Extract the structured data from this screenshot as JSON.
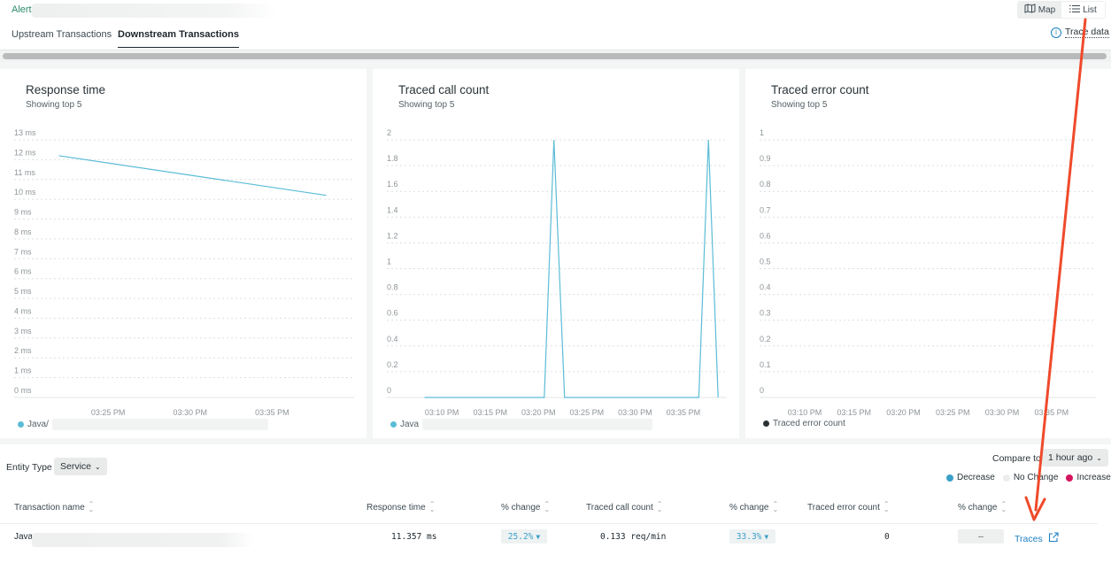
{
  "header": {
    "alert_label": "Alert",
    "tabs": [
      {
        "label": "Upstream Transactions",
        "active": false
      },
      {
        "label": "Downstream Transactions",
        "active": true
      }
    ],
    "view_toggle": [
      {
        "label": "Map",
        "icon": "map-icon",
        "active": false
      },
      {
        "label": "List",
        "icon": "list-icon",
        "active": true
      }
    ],
    "trace_data_label": "Trace data",
    "info_icon": "info-icon"
  },
  "colors": {
    "series": "#5bbcd6",
    "error_series": "#2b3134",
    "decrease": "#3aa0c9",
    "no_change": "#eceeee",
    "increase": "#d6145f",
    "link": "#1b7fc2",
    "annotation_arrow": "#ef4a2b"
  },
  "chart_data": [
    {
      "type": "line",
      "title": "Response time",
      "subtitle": "Showing top 5",
      "xlabel": "",
      "ylabel": "",
      "y_unit": "ms",
      "ylim": [
        0,
        13
      ],
      "yticks": [
        0,
        1,
        2,
        3,
        4,
        5,
        6,
        7,
        8,
        9,
        10,
        11,
        12,
        13
      ],
      "ytick_labels": [
        "0 ms",
        "1 ms",
        "2 ms",
        "3 ms",
        "4 ms",
        "5 ms",
        "6 ms",
        "7 ms",
        "8 ms",
        "9 ms",
        "10 ms",
        "11 ms",
        "12 ms",
        "13 ms"
      ],
      "x_range_min": [
        21.0,
        40.0
      ],
      "xticks_min": [
        25,
        30,
        35
      ],
      "xtick_labels": [
        "03:25 PM",
        "03:30 PM",
        "03:35 PM"
      ],
      "grid": true,
      "legend_position": "bottom-left",
      "series": [
        {
          "name": "Java/",
          "name_redacted": true,
          "x_min": [
            22.0,
            38.3
          ],
          "values": [
            12.2,
            10.2
          ]
        }
      ]
    },
    {
      "type": "line",
      "title": "Traced call count",
      "subtitle": "Showing top 5",
      "xlabel": "",
      "ylabel": "",
      "ylim": [
        0,
        2
      ],
      "yticks": [
        0,
        0.2,
        0.4,
        0.6,
        0.8,
        1,
        1.2,
        1.4,
        1.6,
        1.8,
        2
      ],
      "ytick_labels": [
        "0",
        "0.2",
        "0.4",
        "0.6",
        "0.8",
        "1",
        "1.2",
        "1.4",
        "1.6",
        "1.8",
        "2"
      ],
      "x_range_min": [
        6.5,
        39.5
      ],
      "xticks_min": [
        10,
        15,
        20,
        25,
        30,
        35
      ],
      "xtick_labels": [
        "03:10 PM",
        "03:15 PM",
        "03:20 PM",
        "03:25 PM",
        "03:30 PM",
        "03:35 PM"
      ],
      "grid": true,
      "legend_position": "bottom-left",
      "series": [
        {
          "name": "Java",
          "name_redacted": true,
          "x_min": [
            8.2,
            20.6,
            21.6,
            22.7,
            36.6,
            37.6,
            38.6
          ],
          "values": [
            0,
            0,
            2,
            0,
            0,
            2,
            0
          ]
        }
      ]
    },
    {
      "type": "line",
      "title": "Traced error count",
      "subtitle": "Showing top 5",
      "xlabel": "",
      "ylabel": "",
      "ylim": [
        0,
        1
      ],
      "yticks": [
        0,
        0.1,
        0.2,
        0.3,
        0.4,
        0.5,
        0.6,
        0.7,
        0.8,
        0.9,
        1
      ],
      "ytick_labels": [
        "0",
        "0.1",
        "0.2",
        "0.3",
        "0.4",
        "0.5",
        "0.6",
        "0.7",
        "0.8",
        "0.9",
        "1"
      ],
      "x_range_min": [
        6.5,
        39.5
      ],
      "xticks_min": [
        10,
        15,
        20,
        25,
        30,
        35
      ],
      "xtick_labels": [
        "03:10 PM",
        "03:15 PM",
        "03:20 PM",
        "03:25 PM",
        "03:30 PM",
        "03:35 PM"
      ],
      "grid": true,
      "legend_position": "bottom-left",
      "series": [
        {
          "name": "Traced error count",
          "x_min": [],
          "values": []
        }
      ]
    }
  ],
  "filters": {
    "entity_type_label": "Entity Type",
    "entity_type_value": "Service",
    "compare_label": "Compare to",
    "compare_value": "1 hour ago",
    "change_legend": [
      {
        "label": "Decrease",
        "color_key": "decrease"
      },
      {
        "label": "No Change",
        "color_key": "no_change"
      },
      {
        "label": "Increase",
        "color_key": "increase"
      }
    ]
  },
  "table": {
    "columns": [
      {
        "label": "Transaction name",
        "sortable": true
      },
      {
        "label": "Response time",
        "sortable": true
      },
      {
        "label": "% change",
        "sortable": true
      },
      {
        "label": "Traced call count",
        "sortable": true
      },
      {
        "label": "% change",
        "sortable": true
      },
      {
        "label": "Traced error count",
        "sortable": true
      },
      {
        "label": "% change",
        "sortable": true
      }
    ],
    "rows": [
      {
        "transaction_name": "Java",
        "name_redacted": true,
        "response_time": "11.357 ms",
        "response_time_change": "25.2%",
        "response_time_change_dir": "▼",
        "traced_call_count": "0.133 req/min",
        "traced_call_change": "33.3%",
        "traced_call_change_dir": "▼",
        "traced_error_count": "0",
        "traced_error_change": "–",
        "traces_link": "Traces"
      }
    ]
  }
}
